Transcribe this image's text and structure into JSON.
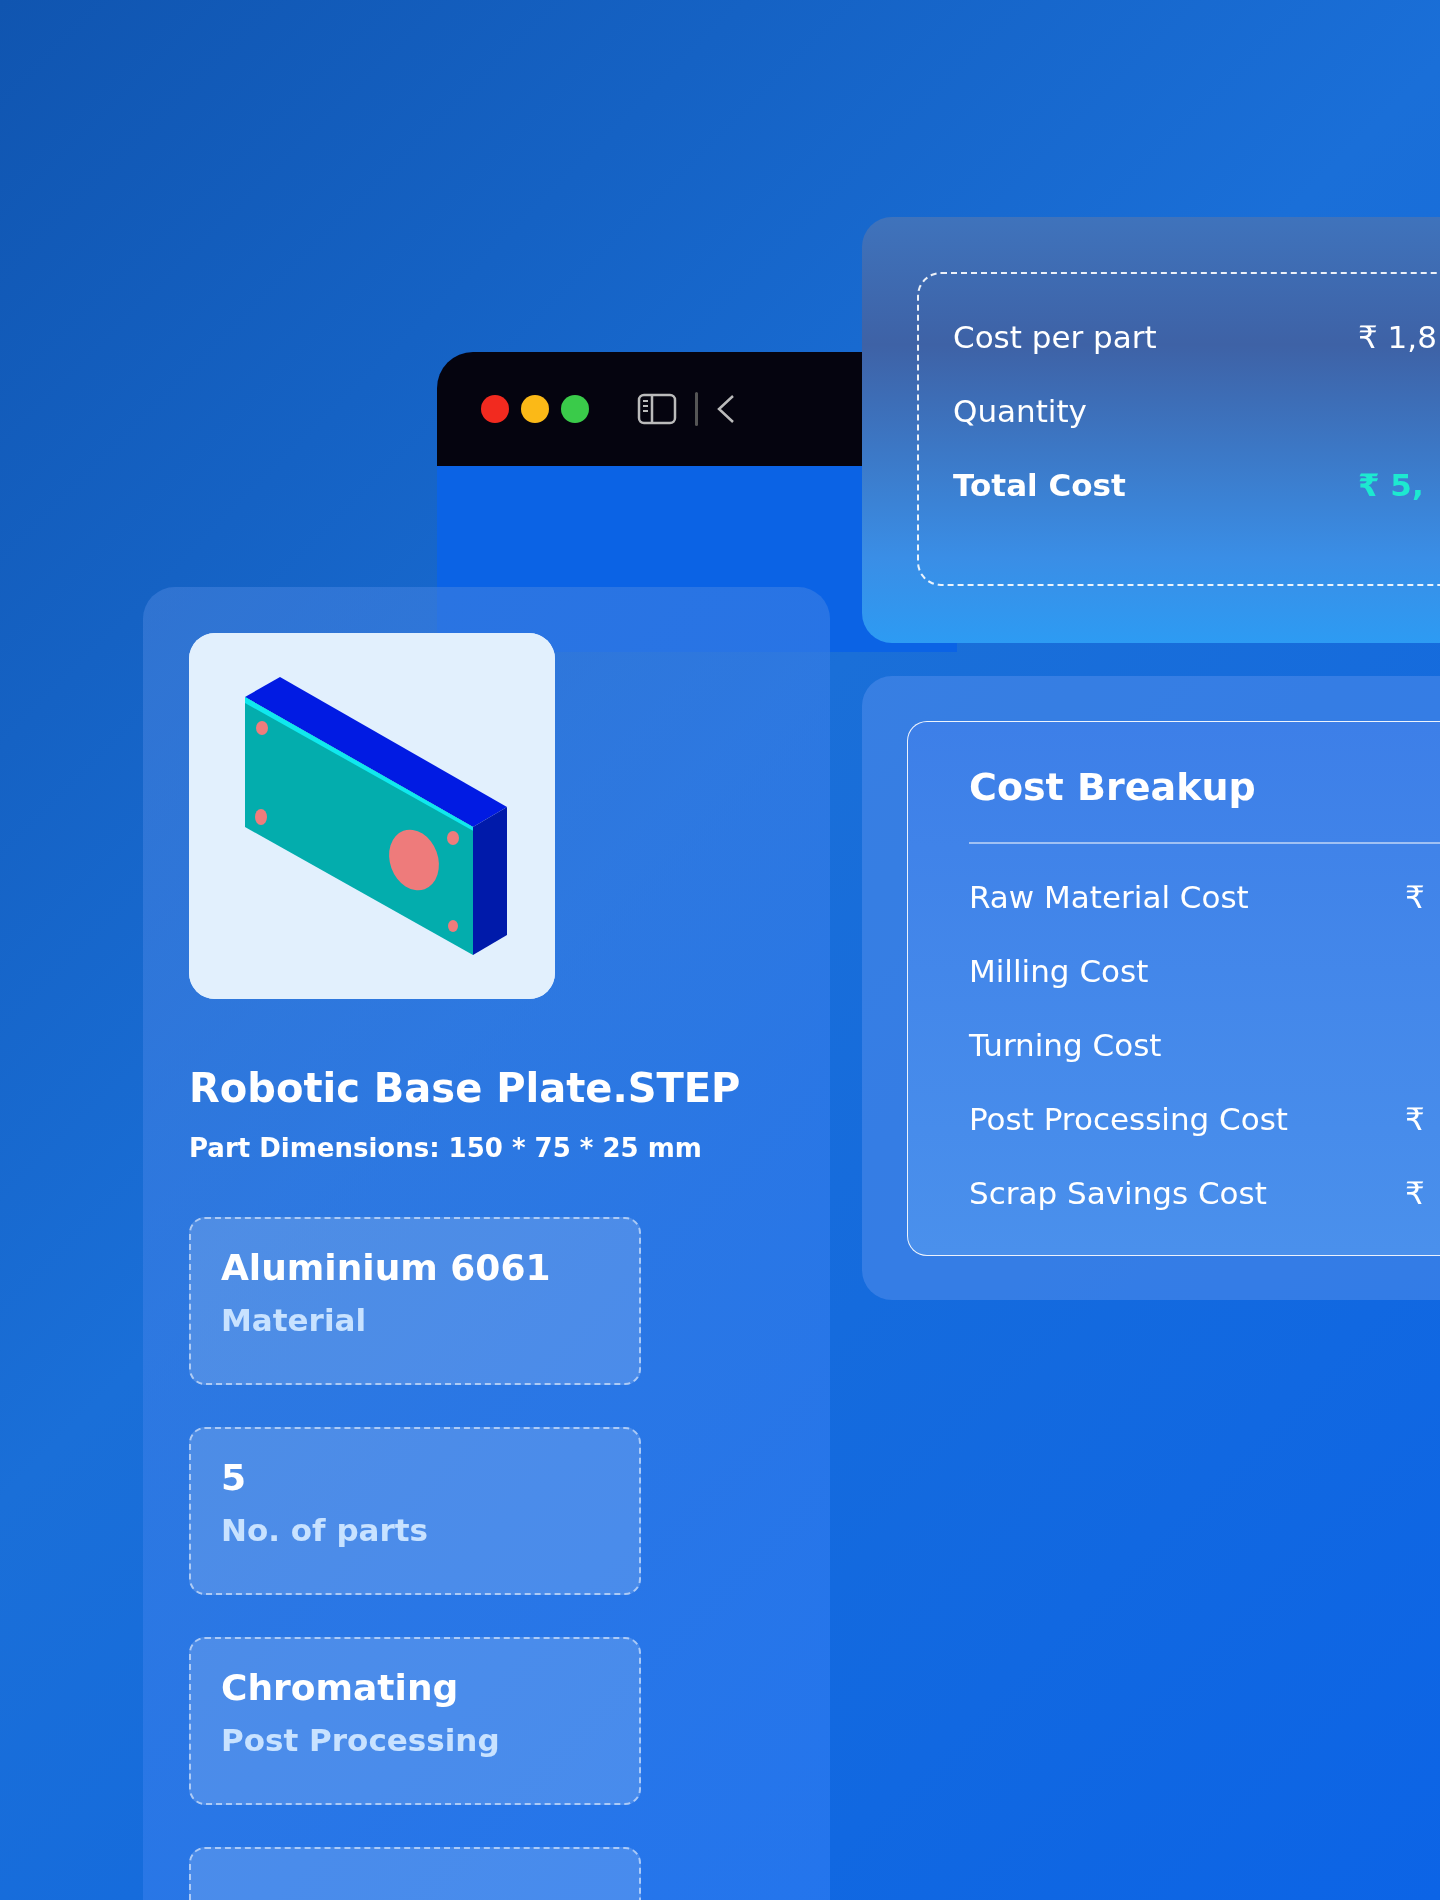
{
  "browser_window": {
    "controls": [
      {
        "color": "#f22a1f"
      },
      {
        "color": "#fbb917"
      },
      {
        "color": "#3acb4a"
      }
    ]
  },
  "summary": {
    "rows": [
      {
        "label": "Cost per part",
        "value": "₹ 1,8",
        "kind": "normal"
      },
      {
        "label": "Quantity",
        "kind": "normal"
      },
      {
        "label": "Total Cost",
        "value": "₹ 5,",
        "kind": "total"
      }
    ]
  },
  "part": {
    "title": "Robotic Base Plate.STEP",
    "dimensions": "Part Dimensions: 150 * 75 * 25 mm",
    "specs": [
      {
        "kind": "filled",
        "value": "Aluminium 6061",
        "label": "Material"
      },
      {
        "kind": "filled",
        "value": "5",
        "label": "No. of parts"
      },
      {
        "kind": "filled",
        "value": "Chromating",
        "label": "Post Processing"
      },
      {
        "kind": "cut"
      }
    ]
  },
  "breakup": {
    "title": "Cost Breakup",
    "rows": [
      {
        "label": "Raw Material Cost",
        "value": "₹"
      },
      {
        "label": "Milling Cost"
      },
      {
        "label": "Turning Cost"
      },
      {
        "label": "Post Processing Cost",
        "value": "₹"
      },
      {
        "label": "Scrap Savings Cost",
        "value": "₹"
      }
    ]
  }
}
